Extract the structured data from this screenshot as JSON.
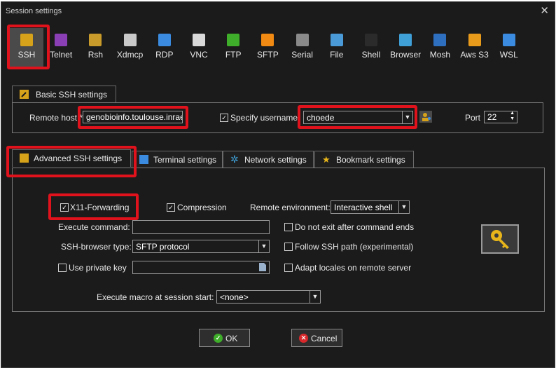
{
  "window": {
    "title": "Session settings",
    "close_glyph": "✕"
  },
  "protocols": [
    {
      "label": "SSH",
      "icon": "ssh-icon",
      "color": "#d6a21a",
      "selected": true
    },
    {
      "label": "Telnet",
      "icon": "telnet-icon",
      "color": "#8a3fb5"
    },
    {
      "label": "Rsh",
      "icon": "rsh-icon",
      "color": "#c89b2a"
    },
    {
      "label": "Xdmcp",
      "icon": "xdmcp-icon",
      "color": "#c9c9c9"
    },
    {
      "label": "RDP",
      "icon": "rdp-icon",
      "color": "#3b8be0"
    },
    {
      "label": "VNC",
      "icon": "vnc-icon",
      "color": "#d9d9d9"
    },
    {
      "label": "FTP",
      "icon": "ftp-icon",
      "color": "#3fae2a"
    },
    {
      "label": "SFTP",
      "icon": "sftp-icon",
      "color": "#f08a12"
    },
    {
      "label": "Serial",
      "icon": "serial-icon",
      "color": "#8a8a8a"
    },
    {
      "label": "File",
      "icon": "file-icon",
      "color": "#4a9ad8"
    },
    {
      "label": "Shell",
      "icon": "shell-icon",
      "color": "#2b2b2b"
    },
    {
      "label": "Browser",
      "icon": "browser-icon",
      "color": "#3fa0d8"
    },
    {
      "label": "Mosh",
      "icon": "mosh-icon",
      "color": "#2f6fc0"
    },
    {
      "label": "Aws S3",
      "icon": "aws-s3-icon",
      "color": "#e89a1a"
    },
    {
      "label": "WSL",
      "icon": "wsl-icon",
      "color": "#3b8be0"
    }
  ],
  "basic": {
    "tab_label": "Basic SSH settings",
    "remote_host_label": "Remote host *",
    "remote_host_value": "genobioinfo.toulouse.inrae.fr",
    "specify_username_label": "Specify username",
    "specify_username_checked": true,
    "username_value": "choede",
    "port_label": "Port",
    "port_value": "22"
  },
  "tabs": [
    {
      "label": "Advanced SSH settings",
      "icon": "wrench-icon",
      "active": true
    },
    {
      "label": "Terminal settings",
      "icon": "terminal-icon"
    },
    {
      "label": "Network settings",
      "icon": "network-icon"
    },
    {
      "label": "Bookmark settings",
      "icon": "star-icon"
    }
  ],
  "advanced": {
    "x11_label": "X11-Forwarding",
    "x11_checked": true,
    "compression_label": "Compression",
    "compression_checked": true,
    "remote_env_label": "Remote environment:",
    "remote_env_value": "Interactive shell",
    "exec_cmd_label": "Execute command:",
    "exec_cmd_value": "",
    "no_exit_label": "Do not exit after command ends",
    "no_exit_checked": false,
    "browser_type_label": "SSH-browser type:",
    "browser_type_value": "SFTP protocol",
    "follow_path_label": "Follow SSH path (experimental)",
    "follow_path_checked": false,
    "private_key_label": "Use private key",
    "private_key_checked": false,
    "private_key_value": "",
    "adapt_locales_label": "Adapt locales on remote server",
    "adapt_locales_checked": false,
    "macro_label": "Execute macro at session start:",
    "macro_value": "<none>"
  },
  "buttons": {
    "ok": "OK",
    "cancel": "Cancel"
  },
  "colors": {
    "highlight": "#e0121c",
    "ok": "#3fae2a",
    "cancel": "#d9282b",
    "key": "#e8b61a"
  }
}
